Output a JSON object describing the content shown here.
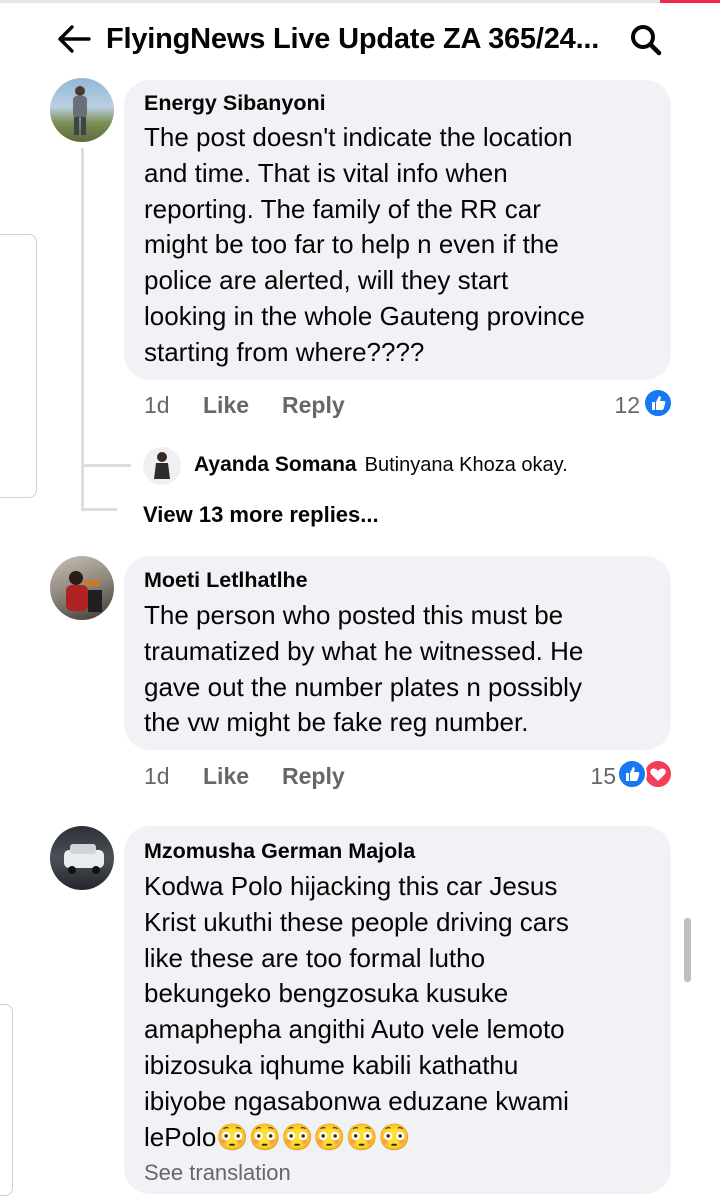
{
  "header": {
    "title": "FlyingNews Live Update ZA 365/24...",
    "back_icon": "arrow-left-icon",
    "search_icon": "search-icon"
  },
  "comments": [
    {
      "author": "Energy Sibanyoni",
      "text": "The post doesn't  indicate the location\nand time. That is vital info when\nreporting. The family of the RR car\nmight be too far to help n even if the\npolice are alerted,  will they start\nlooking in the whole Gauteng province\nstarting from where????",
      "time": "1d",
      "like_label": "Like",
      "reply_label": "Reply",
      "reaction_count": "12",
      "reactions": [
        "like"
      ]
    },
    {
      "author": "Moeti Letlhatlhe",
      "text": "The person who posted this must be\ntraumatized by what he witnessed. He\ngave out the number plates n possibly\nthe vw might be fake reg number.",
      "time": "1d",
      "like_label": "Like",
      "reply_label": "Reply",
      "reaction_count": "15",
      "reactions": [
        "like",
        "love"
      ]
    },
    {
      "author": "Mzomusha German Majola",
      "text": "Kodwa Polo hijacking this car Jesus\nKrist ukuthi these people driving cars\nlike these are too formal lutho\nbekungeko bengzosuka kusuke\namaphepha angithi Auto vele lemoto\nibizosuka iqhume kabili kathathu\nibiyobe ngasabonwa eduzane kwami\nlePolo😳😳😳😳😳😳",
      "see_translation": "See translation"
    }
  ],
  "reply_preview": {
    "author": "Ayanda Somana",
    "text": "Butinyana Khoza okay."
  },
  "view_more_replies": "View 13 more replies...",
  "colors": {
    "bubble": "#f0f2f5",
    "meta_text": "#65676b",
    "like_blue": "#1877f2",
    "love_red": "#f33e58"
  }
}
